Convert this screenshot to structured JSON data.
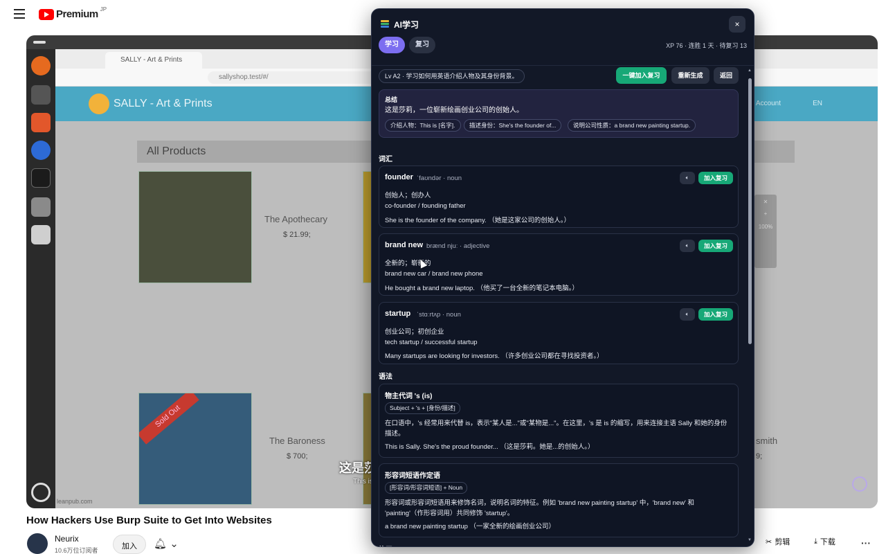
{
  "youtube": {
    "logo_text": "Premium",
    "logo_sup": "JP",
    "video_title": "How Hackers Use Burp Suite to Get Into Websites",
    "channel_name": "Neurix",
    "channel_subs": "10.6万位订阅者",
    "join_label": "加入",
    "actions": {
      "clip_label": "剪辑",
      "download_label": "下载"
    }
  },
  "video_frame": {
    "browser_tab_title": "SALLY - Art & Prints",
    "address_url": "sallyshop.test/#/",
    "site_title": "SALLY - Art & Prints",
    "account_label": "Account",
    "lang_label": "EN",
    "products_heading": "All Products",
    "products": [
      {
        "name": "The Apothecary",
        "price": "$ 21.99;"
      },
      {
        "name": "The Baroness",
        "price": "$ 700;"
      }
    ],
    "partial_name": "smith",
    "partial_price": "9;",
    "sold_out_label": "Sold Out",
    "zoom_label": "100%",
    "watermark": "leanpub.com",
    "subtitle_cn": "这是莎莉",
    "subtitle_en": "This is Sally."
  },
  "panel": {
    "title": "AI学习",
    "close_label": "×",
    "tabs": [
      {
        "label": "学习",
        "active": true
      },
      {
        "label": "复习",
        "active": false
      }
    ],
    "stats": "XP 76 · 连胜 1 天 · 待复习 13",
    "level_pill": "Lv A2 · 学习如何用英语介绍人物及其身份背景。",
    "buttons": {
      "add_all": "一键加入复习",
      "regenerate": "重新生成",
      "back": "返回"
    },
    "summary": {
      "label": "总结",
      "text": "这是莎莉，一位崭新绘画创业公司的创始人。",
      "chips": [
        "介绍人物：This is [名字].",
        "描述身份：She's the founder of...",
        "说明公司性质：a brand new painting startup."
      ]
    },
    "vocab_heading": "词汇",
    "vocab": [
      {
        "word": "founder",
        "phonetic": "ˈfaʊndər · noun",
        "meaning": "创始人；创办人",
        "collocations": "co-founder / founding father",
        "example": "She is the founder of the company. （她是这家公司的创始人。）",
        "speak_icon": "speaker-icon",
        "add_label": "加入复习"
      },
      {
        "word": "brand new",
        "phonetic": "brænd njuː · adjective",
        "meaning": "全新的；崭新的",
        "collocations": "brand new car / brand new phone",
        "example": "He bought a brand new laptop. （他买了一台全新的笔记本电脑。）",
        "speak_icon": "speaker-icon",
        "add_label": "加入复习"
      },
      {
        "word": "startup",
        "phonetic": "ˈstɑːrtʌp · noun",
        "meaning": "创业公司；初创企业",
        "collocations": "tech startup / successful startup",
        "example": "Many startups are looking for investors. （许多创业公司都在寻找投资者。）",
        "speak_icon": "speaker-icon",
        "add_label": "加入复习"
      }
    ],
    "grammar_heading": "语法",
    "grammar": [
      {
        "title": "物主代词 's (is)",
        "pattern": "Subject + 's + [身份/描述]",
        "explanation": "在口语中，'s 经常用来代替 is，表示\"某人是...\"或\"某物是...\"。在这里，'s 是 is 的缩写，用来连接主语 Sally 和她的身份描述。",
        "example": "This is Sally. She's the proud founder... （这是莎莉。她是...的创始人。）"
      },
      {
        "title": "形容词短语作定语",
        "pattern": "[形容词/形容词短语] + Noun",
        "explanation": "形容词或形容词短语用来修饰名词，说明名词的特征。例如 'brand new painting startup' 中，'brand new' 和 'painting'（作形容词用）共同修饰 'startup'。",
        "example": "a brand new painting startup （一家全新的绘画创业公司）"
      }
    ],
    "practice_heading": "练习"
  }
}
